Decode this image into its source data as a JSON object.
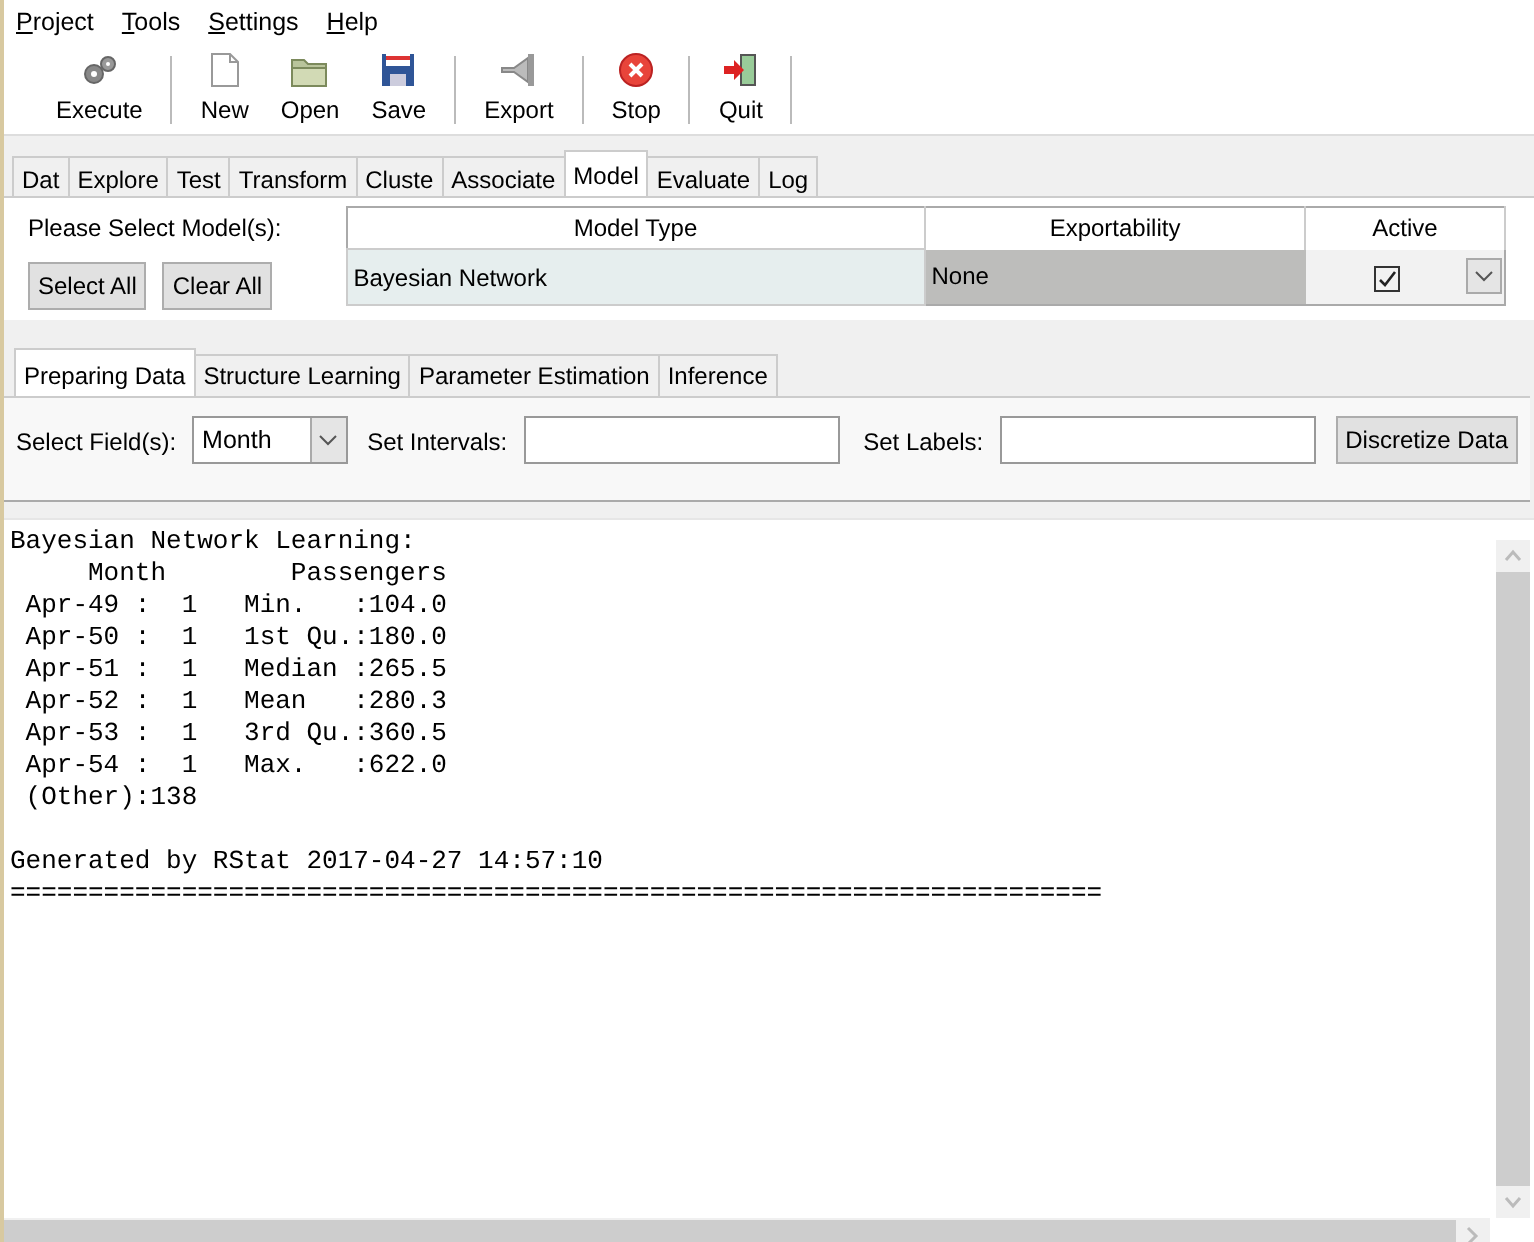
{
  "menu": [
    {
      "label": "Project"
    },
    {
      "label": "Tools"
    },
    {
      "label": "Settings"
    },
    {
      "label": "Help"
    }
  ],
  "toolbar": [
    [
      {
        "label": "Execute",
        "kind": "gears"
      }
    ],
    [
      {
        "label": "New",
        "kind": "page"
      },
      {
        "label": "Open",
        "kind": "folder"
      },
      {
        "label": "Save",
        "kind": "disk"
      }
    ],
    [
      {
        "label": "Export",
        "kind": "plug"
      }
    ],
    [
      {
        "label": "Stop",
        "kind": "stop"
      }
    ],
    [
      {
        "label": "Quit",
        "kind": "door"
      }
    ]
  ],
  "tabs": [
    {
      "label": "Dat",
      "selected": false
    },
    {
      "label": "Explore",
      "selected": false
    },
    {
      "label": "Test",
      "selected": false
    },
    {
      "label": "Transform",
      "selected": false
    },
    {
      "label": "Cluste",
      "selected": false
    },
    {
      "label": "Associate",
      "selected": false
    },
    {
      "label": "Model",
      "selected": true
    },
    {
      "label": "Evaluate",
      "selected": false
    },
    {
      "label": "Log",
      "selected": false
    }
  ],
  "model_select": {
    "label": "Please Select Model(s):",
    "buttons": [
      "Select All",
      "Clear All"
    ]
  },
  "model_table": {
    "columns": [
      "Model Type",
      "Exportability",
      "Active"
    ],
    "rows": [
      {
        "model_type": "Bayesian Network",
        "exportability": "None",
        "active": true
      }
    ]
  },
  "sub_tabs": [
    {
      "label": "Preparing Data",
      "selected": true
    },
    {
      "label": "Structure Learning",
      "selected": false
    },
    {
      "label": "Parameter Estimation",
      "selected": false
    },
    {
      "label": "Inference",
      "selected": false
    }
  ],
  "fields": {
    "select_label": "Select Field(s):",
    "select_value": "Month",
    "intervals_label": "Set Intervals:",
    "labels_label": "Set Labels:",
    "button": "Discretize Data"
  },
  "output": {
    "summary": [
      "Bayesian Network Learning:",
      "     Month        Passengers",
      " Apr-49 :  1   Min.   :104.0",
      " Apr-50 :  1   1st Qu.:180.0",
      " Apr-51 :  1   Median :265.5",
      " Apr-52 :  1   Mean   :280.3",
      " Apr-53 :  1   3rd Qu.:360.5",
      " Apr-54 :  1   Max.   :622.0",
      " (Other):138"
    ],
    "footer": [
      "Generated by RStat 2017-04-27 14:57:10",
      "======================================================================"
    ]
  }
}
